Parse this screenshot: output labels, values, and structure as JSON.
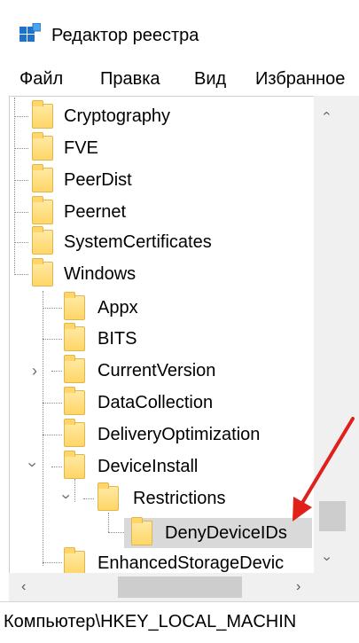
{
  "window": {
    "title": "Редактор реестра",
    "app_icon": "regedit-icon"
  },
  "menu": {
    "items": [
      "Файл",
      "Правка",
      "Вид",
      "Избранное"
    ]
  },
  "tree": {
    "nodes": [
      {
        "label": "Cryptography",
        "depth": 0,
        "expander": "none"
      },
      {
        "label": "FVE",
        "depth": 0,
        "expander": "none"
      },
      {
        "label": "PeerDist",
        "depth": 0,
        "expander": "none"
      },
      {
        "label": "Peernet",
        "depth": 0,
        "expander": "none"
      },
      {
        "label": "SystemCertificates",
        "depth": 0,
        "expander": "none"
      },
      {
        "label": "Windows",
        "depth": 0,
        "expander": "expanded"
      },
      {
        "label": "Appx",
        "depth": 1,
        "expander": "none"
      },
      {
        "label": "BITS",
        "depth": 1,
        "expander": "none"
      },
      {
        "label": "CurrentVersion",
        "depth": 1,
        "expander": "collapsed"
      },
      {
        "label": "DataCollection",
        "depth": 1,
        "expander": "none"
      },
      {
        "label": "DeliveryOptimization",
        "depth": 1,
        "expander": "none"
      },
      {
        "label": "DeviceInstall",
        "depth": 1,
        "expander": "expanded"
      },
      {
        "label": "Restrictions",
        "depth": 2,
        "expander": "expanded"
      },
      {
        "label": "DenyDeviceIDs",
        "depth": 3,
        "expander": "none",
        "selected": true
      },
      {
        "label": "EnhancedStorageDevic",
        "depth": 1,
        "expander": "none"
      }
    ]
  },
  "statusbar": {
    "path": "Компьютер\\HKEY_LOCAL_MACHIN"
  },
  "colors": {
    "folder": "#ffd667",
    "selection": "#d9d9d9",
    "annotation_arrow": "#e0201b"
  }
}
